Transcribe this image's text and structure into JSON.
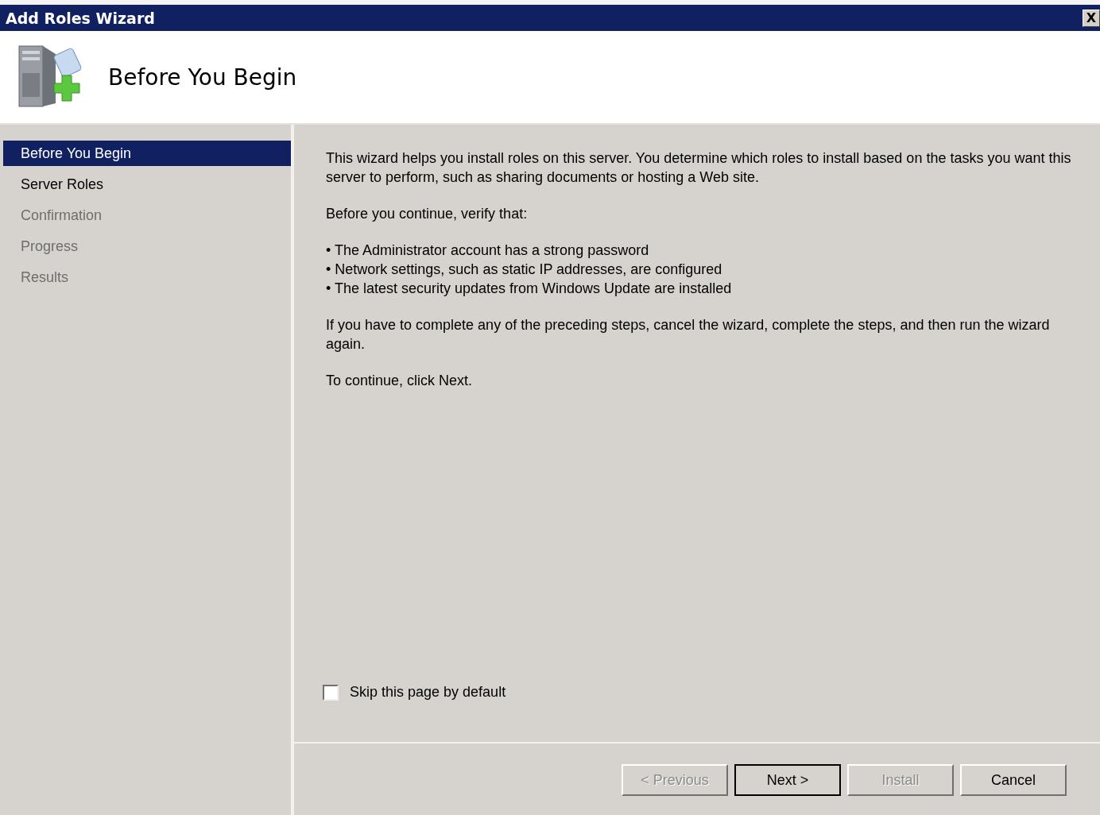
{
  "window": {
    "title": "Add Roles Wizard",
    "close": "X"
  },
  "header": {
    "title": "Before You Begin"
  },
  "steps": [
    {
      "label": "Before You Begin",
      "selected": true,
      "disabled": false
    },
    {
      "label": "Server Roles",
      "selected": false,
      "disabled": false
    },
    {
      "label": "Confirmation",
      "selected": false,
      "disabled": true
    },
    {
      "label": "Progress",
      "selected": false,
      "disabled": true
    },
    {
      "label": "Results",
      "selected": false,
      "disabled": true
    }
  ],
  "content": [
    {
      "kind": "paragraph",
      "text": "This wizard helps you install roles on this server. You determine which roles to install based on the tasks you want this server to perform, such as sharing documents or hosting a Web site."
    },
    {
      "kind": "paragraph",
      "text": "Before you continue, verify that:"
    },
    {
      "kind": "bullets",
      "items": [
        "• The Administrator account has a strong password",
        "• Network settings, such as static IP addresses, are configured",
        "• The latest security updates from Windows Update are installed"
      ]
    },
    {
      "kind": "paragraph",
      "text": "If you have to complete any of the preceding steps, cancel the wizard, complete the steps, and then run the wizard again."
    },
    {
      "kind": "paragraph",
      "text": "To continue, click Next."
    }
  ],
  "skip_checkbox": {
    "label": "Skip this page by default",
    "checked": false
  },
  "buttons": [
    {
      "label": "< Previous",
      "disabled": true,
      "default": false
    },
    {
      "label": "Next >",
      "disabled": false,
      "default": true
    },
    {
      "label": "Install",
      "disabled": true,
      "default": false
    },
    {
      "label": "Cancel",
      "disabled": false,
      "default": false
    }
  ]
}
